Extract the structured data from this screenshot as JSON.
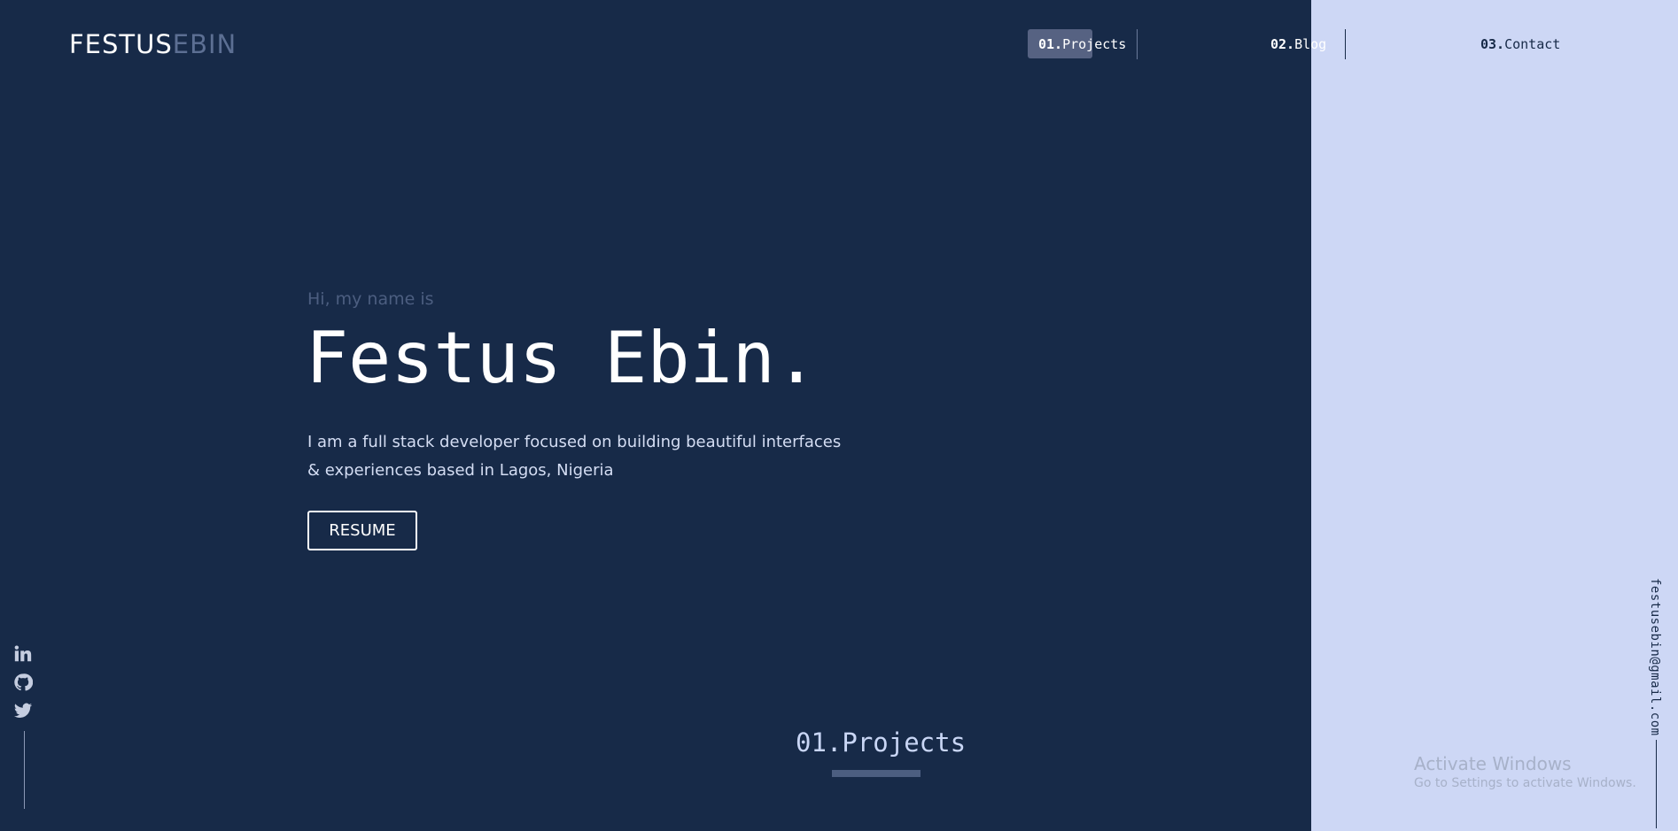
{
  "logo": {
    "first": "FESTUS",
    "second": "EBIN"
  },
  "nav": {
    "items": [
      {
        "num": "01.",
        "label": "Projects"
      },
      {
        "num": "02.",
        "label": "Blog"
      },
      {
        "num": "03.",
        "label": "Contact"
      }
    ],
    "active_index": 0
  },
  "hero": {
    "intro": "Hi, my name is",
    "name": "Festus Ebin.",
    "description_line1": "I am a full stack developer focused on building beautiful interfaces",
    "description_line2": "& experiences based in Lagos, Nigeria",
    "resume_label": "RESUME"
  },
  "social": {
    "icons": [
      "linkedin-icon",
      "github-icon",
      "twitter-icon"
    ]
  },
  "section": {
    "title": "01.Projects"
  },
  "email": "festusebin@gmail.com",
  "watermark": {
    "title": "Activate Windows",
    "subtitle": "Go to Settings to activate Windows."
  },
  "colors": {
    "background": "#172a48",
    "side_panel": "#cdd7f5",
    "accent": "#566282",
    "muted": "#4c5e80"
  }
}
